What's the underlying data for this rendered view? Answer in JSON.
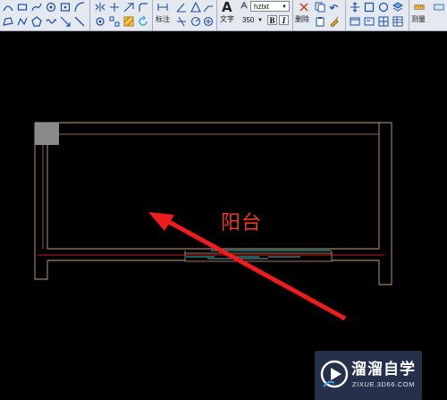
{
  "toolbar": {
    "dimension_label": "标注",
    "text_label": "文字",
    "font_name": "hztxt",
    "font_size": "350",
    "bold_label": "B",
    "italic_label": "I",
    "delete_label": "删除",
    "measure_label": "测量"
  },
  "drawing": {
    "room_label": "阳台"
  },
  "watermark": {
    "brand": "溜溜自学",
    "url": "ZIXUE.3D66.COM"
  },
  "colors": {
    "wall": "#c9a27a",
    "axis_red": "#ff2020",
    "window_cyan": "#25c4cc",
    "arrow": "#ee1c1c",
    "room_label": "#e83a24",
    "grip": "#8a8a8a"
  }
}
